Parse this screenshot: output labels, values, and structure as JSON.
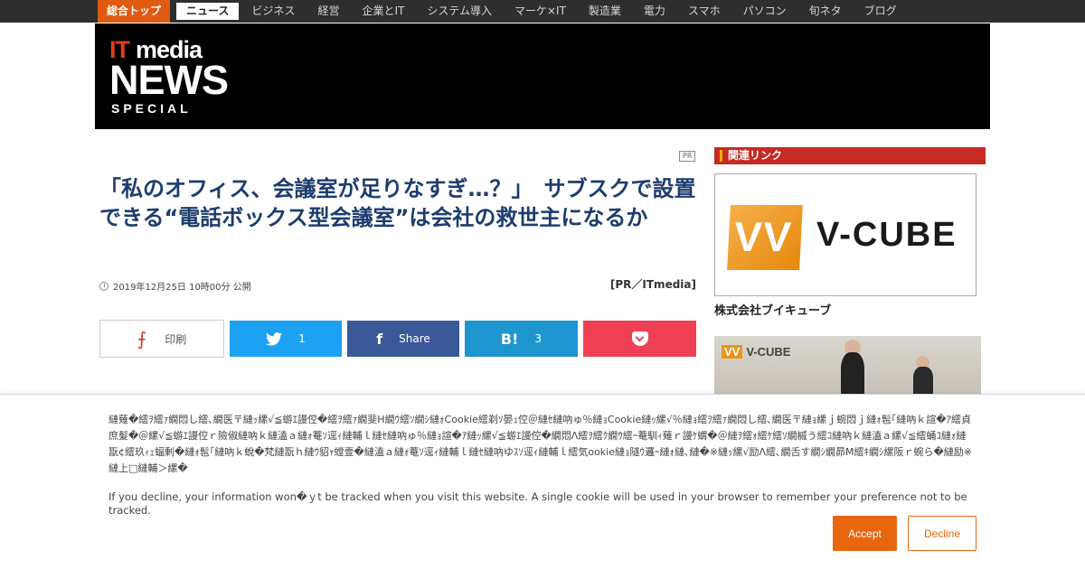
{
  "nav": {
    "items": [
      "総合トップ",
      "ニュース",
      "ビジネス",
      "経営",
      "企業とIT",
      "システム導入",
      "マーケ×IT",
      "製造業",
      "電力",
      "スマホ",
      "パソコン",
      "旬ネタ",
      "ブログ"
    ]
  },
  "logo": {
    "it": "IT",
    "media": "media",
    "news": "NEWS",
    "special": "SPECIAL"
  },
  "article": {
    "pr_tag": "PR",
    "title": "「私のオフィス、会議室が足りなすぎ…？」　サブスクで設置できる“電話ボックス型会議室”は会社の救世主になるか",
    "date": "2019年12月25日 10時00分 公開",
    "byline": "[PR／ITmedia]"
  },
  "share": {
    "print_label": "印刷",
    "twitter_count": "1",
    "facebook_label": "Share",
    "hatena_icon": "B!",
    "hatena_count": "3"
  },
  "sidebar": {
    "heading": "関連リンク",
    "logo_text": "V-CUBE",
    "company": "株式会社ブイキューブ",
    "photo_sign": "V-CUBE"
  },
  "cookie": {
    "message_garbled": "縺薙�繧ｦ繧ｧ繝悶し繧､繝医〒縺ｯ縲√≦蝣ｴ謾倥�繧ｦ繧ｧ繝斐H繝ｳ繧ｿ繝ｼ縺ｫCookie繧剃ｿ晏ｭ倥＠縺ｾ縺吶ゅ％縺ｮCookie縺ｯ縲√％縺ｮ繧ｦ繧ｧ繝悶し繧､繝医〒縺ｮ縲ｊ蜿悶ｊ縺ｫ髢｢縺吶ｋ諠�ｱ繧貞庶髮�＠縲√≦蝣ｴ謾倥ｒ險俶縺吶ｋ縺溘ａ縺ｫ菴ｿ逕ｨ縺輔ｌ縺ｾ縺吶ゅ％縺ｮ諠�ｱ縺ｯ縲√≦蝣ｴ謾倥�繝悶Λ繧ｦ繧ｸ繝ｳ繧ｰ菴馴ｨ薙ｒ謾ｹ蝟�＠縺ｦ繧ｫ繧ｹ繧ｿ繝槭う繧ｺ縺吶ｋ縺溘ａ縲√≦繧蛹ｺ縺ｫ縺翫¢繧玖ｨｪ蝠剰�縺ｫ髢｢縺吶ｋ蛻�梵縺翫ｈ縺ｳ貂ｬ螳壹�縺溘ａ縺ｫ菴ｿ逕ｨ縺輔ｌ縺ｾ縺吶ゆｽｿ逕ｨ縺輔ｌ繧気ookie縺ｮ隧ｳ邏ｰ縺ｫ縺､縺�※縺ｯ縲√励Λ繧､繝舌す繝ｼ繝昴Μ繧ｷ繝ｼ縲阪ｒ蜿ら�縺励※縺上□縺輔＞縲�",
    "message": "If you decline, your information won�ｙt be tracked when you visit this website. A single cookie will be used in your browser to remember your preference not to be tracked.",
    "accept_label": "Accept",
    "decline_label": "Decline"
  }
}
